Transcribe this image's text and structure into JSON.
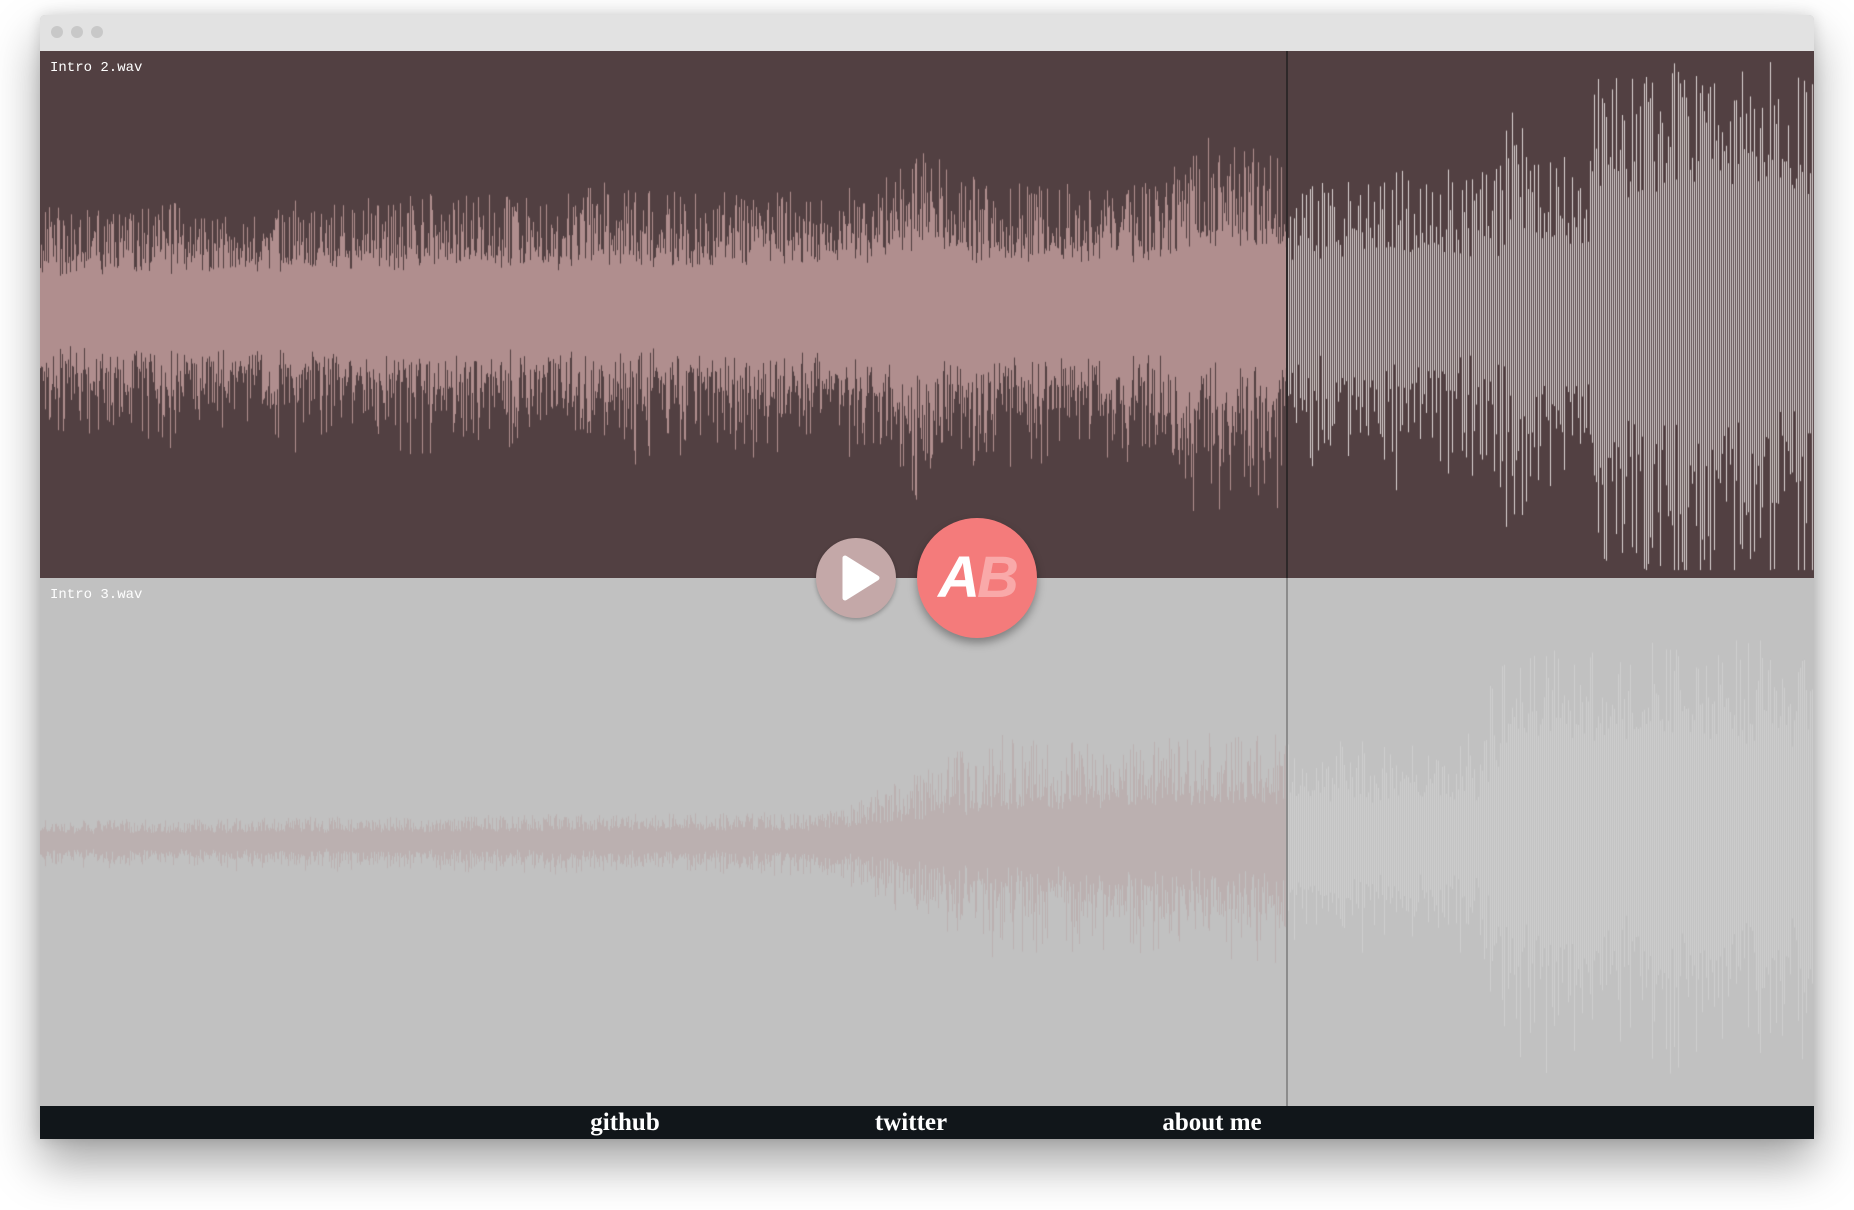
{
  "window_controls": [
    "close-dot-icon",
    "minimize-dot-icon",
    "zoom-dot-icon"
  ],
  "tracks": [
    {
      "file_name": "Intro 2.wav",
      "active": true
    },
    {
      "file_name": "Intro 3.wav",
      "active": false
    }
  ],
  "player": {
    "playback_progress": 0.703,
    "play_icon": "play-icon"
  },
  "ab_toggle": {
    "label_a": "A",
    "label_b": "B"
  },
  "footer": {
    "links": [
      {
        "label": "github"
      },
      {
        "label": "twitter"
      },
      {
        "label": "about me"
      }
    ]
  },
  "colors": {
    "titlebar_bg": "#e2e2e2",
    "active_track_bg": "#524042",
    "active_wave_played": "#b08e8e",
    "active_wave_unplayed": "#dcd5d4",
    "active_playhead": "#2e2829",
    "inactive_track_bg": "#c1c1c1",
    "inactive_wave_played": "#bbb0b0",
    "inactive_wave_unplayed": "#cecece",
    "inactive_playhead": "#8c8c8c",
    "play_button": "#c4a8a8",
    "ab_button": "#f47b7b",
    "ab_label_b": "#f9a9a9",
    "footer_bg": "#11161a"
  }
}
